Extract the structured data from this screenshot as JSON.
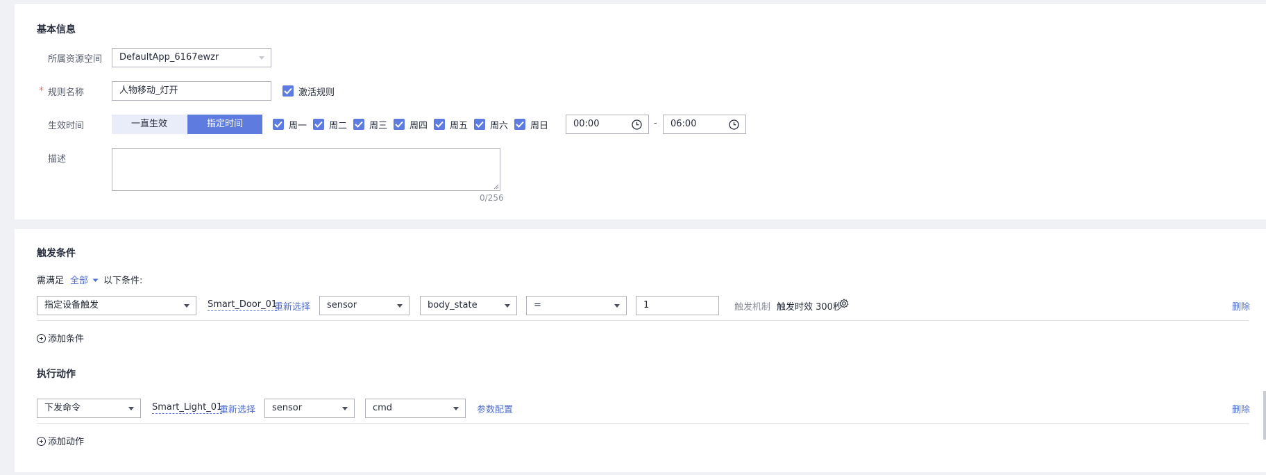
{
  "basic": {
    "title": "基本信息",
    "resource_space_label": "所属资源空间",
    "resource_space_value": "DefaultApp_6167ewzr",
    "rule_name_required": "*",
    "rule_name_label": "规则名称",
    "rule_name_value": "人物移动_灯开",
    "activate_label": "激活规则",
    "effective_time_label": "生效时间",
    "always_btn": "一直生效",
    "specified_btn": "指定时间",
    "days": [
      "周一",
      "周二",
      "周三",
      "周四",
      "周五",
      "周六",
      "周日"
    ],
    "time_start": "00:00",
    "time_sep": "-",
    "time_end": "06:00",
    "desc_label": "描述",
    "desc_value": "",
    "desc_counter": "0/256"
  },
  "trigger": {
    "title": "触发条件",
    "need_meet": "需满足",
    "mode": "全部",
    "conditions_suffix": "以下条件:",
    "type_value": "指定设备触发",
    "device_name": "Smart_Door_01",
    "reselect": "重新选择",
    "service_value": "sensor",
    "property_value": "body_state",
    "operator_value": "=",
    "compare_value": "1",
    "mechanism_label": "触发机制",
    "mechanism_value": "触发时效 300秒",
    "delete": "删除",
    "add_condition": "添加条件"
  },
  "action": {
    "title": "执行动作",
    "type_value": "下发命令",
    "device_name": "Smart_Light_01",
    "reselect": "重新选择",
    "service_value": "sensor",
    "command_value": "cmd",
    "param_config": "参数配置",
    "delete": "删除",
    "add_action": "添加动作"
  },
  "colors": {
    "primary": "#5e7ce0",
    "link": "#526ecc",
    "required": "#f66f6a"
  },
  "icons": [
    "clock-icon",
    "checkmark-icon",
    "caret-down-icon",
    "gear-icon",
    "plus-circle-icon"
  ]
}
